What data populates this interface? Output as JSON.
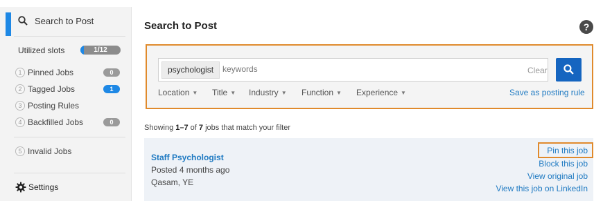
{
  "sidebar": {
    "search_label": "Search to Post",
    "search_icon": "search-icon",
    "slots": {
      "label": "Utilized slots",
      "value": "1/12",
      "fraction": 0.083
    },
    "items": [
      {
        "num": "1",
        "label": "Pinned Jobs",
        "badge": "0",
        "badge_color": "#9a9a9a"
      },
      {
        "num": "2",
        "label": "Tagged Jobs",
        "badge": "1",
        "badge_color": "#1e88e5"
      },
      {
        "num": "3",
        "label": "Posting Rules",
        "badge": null
      },
      {
        "num": "4",
        "label": "Backfilled Jobs",
        "badge": "0",
        "badge_color": "#9a9a9a"
      },
      {
        "num": "5",
        "label": "Invalid Jobs",
        "badge": null
      }
    ],
    "settings_label": "Settings",
    "settings_icon": "gear-icon"
  },
  "main": {
    "title": "Search to Post",
    "help_icon": "?",
    "search": {
      "chip": "psychologist",
      "placeholder": "keywords",
      "clear_label": "Clear",
      "button_icon": "search-icon",
      "filters": [
        "Location",
        "Title",
        "Industry",
        "Function",
        "Experience"
      ],
      "save_rule_label": "Save as posting rule"
    },
    "results": {
      "prefix": "Showing ",
      "range": "1–7",
      "of": " of ",
      "total": "7",
      "suffix": " jobs that match your filter"
    },
    "job": {
      "title": "Staff Psychologist",
      "posted": "Posted 4 months ago",
      "location": "Qasam, YE",
      "actions": [
        "Pin this job",
        "Block this job",
        "View original job",
        "View this job on LinkedIn"
      ]
    }
  },
  "colors": {
    "accent": "#1e88e5",
    "link": "#1f7ac2",
    "highlight": "#e08a2c",
    "search_button": "#1565c0"
  }
}
